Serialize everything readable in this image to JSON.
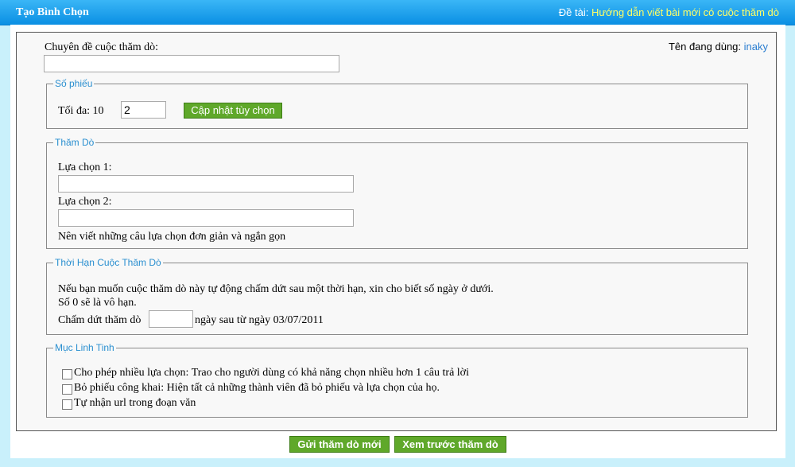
{
  "header": {
    "title": "Tạo Bình Chọn",
    "topic_label": "Đề tài:",
    "topic_value": "Hướng dẫn viết bài mới có cuộc thăm dò"
  },
  "user": {
    "label": "Tên đang dùng:",
    "name": "inaky"
  },
  "subject": {
    "label": "Chuyên đề cuộc thăm dò:",
    "value": ""
  },
  "votes": {
    "legend": "Số phiếu",
    "max_label": "Tối đa: 10",
    "value": "2",
    "update_button": "Cập nhật tùy chọn"
  },
  "poll": {
    "legend": "Thăm Dò",
    "option1_label": "Lựa chọn 1:",
    "option1_value": "",
    "option2_label": "Lựa chọn 2:",
    "option2_value": "",
    "hint": "Nên viết những câu lựa chọn đơn giản và ngắn gọn"
  },
  "duration": {
    "legend": "Thời Hạn Cuộc Thăm Dò",
    "line1": "Nếu bạn muốn cuộc thăm dò này tự động chấm dứt sau một thời hạn, xin cho biết số ngày ở dưới.",
    "line2": "Số 0 sẽ là vô hạn.",
    "end_label": "Chấm dứt thăm dò",
    "end_value": "",
    "end_suffix": "ngày sau từ ngày 03/07/2011"
  },
  "misc": {
    "legend": "Mục Linh Tinh",
    "options": [
      {
        "label": "Cho phép nhiều lựa chọn: Trao cho người dùng có khả năng chọn nhiều hơn 1 câu trả lời",
        "checked": false
      },
      {
        "label": "Bỏ phiếu công khai: Hiện tất cả những thành viên đã bỏ phiếu và lựa chọn của họ.",
        "checked": false
      },
      {
        "label": "Tự nhận url trong đoạn văn",
        "checked": false
      }
    ]
  },
  "actions": {
    "submit": "Gửi thăm dò mới",
    "preview": "Xem trước thăm dò"
  }
}
